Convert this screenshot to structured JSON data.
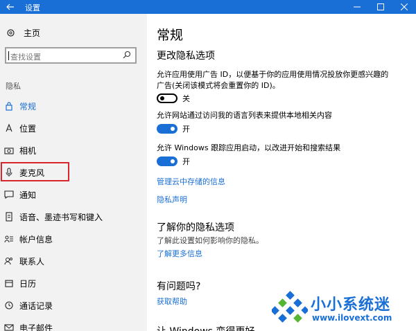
{
  "window": {
    "title": "设置",
    "back_icon": "back-arrow-icon",
    "controls": [
      "minimize-icon",
      "maximize-icon",
      "close-icon"
    ],
    "titlebar_color": "#1a6fd6"
  },
  "sidebar": {
    "home_label": "主页",
    "search_placeholder": "查找设置",
    "section_label": "隐私",
    "items": [
      {
        "label": "常规",
        "icon": "lock-icon",
        "active": true
      },
      {
        "label": "位置",
        "icon": "location-icon"
      },
      {
        "label": "相机",
        "icon": "camera-icon"
      },
      {
        "label": "麦克风",
        "icon": "microphone-icon",
        "highlighted": true
      },
      {
        "label": "通知",
        "icon": "notification-icon"
      },
      {
        "label": "语音、墨迹书写和键入",
        "icon": "speech-icon"
      },
      {
        "label": "帐户信息",
        "icon": "account-info-icon"
      },
      {
        "label": "联系人",
        "icon": "contacts-icon"
      },
      {
        "label": "日历",
        "icon": "calendar-icon"
      },
      {
        "label": "通话记录",
        "icon": "call-history-icon"
      },
      {
        "label": "电子邮件",
        "icon": "email-icon"
      }
    ]
  },
  "main": {
    "title": "常规",
    "section1_title": "更改隐私选项",
    "option1_text": "允许应用使用广告 ID，以便基于你的应用使用情况投放你更感兴趣的广告(关闭该模式将会重置你的 ID)。",
    "option1_state": "关",
    "option2_text": "允许网站通过访问我的语言列表来提供本地相关内容",
    "option2_state": "开",
    "option3_text": "允许 Windows 跟踪应用启动，以改进开始和搜索结果",
    "option3_state": "开",
    "link_cloud": "管理云中存储的信息",
    "link_privacy": "隐私声明",
    "section2_title": "了解你的隐私选项",
    "section2_desc": "了解此设置如何影响你的隐私。",
    "link_more": "了解更多信息",
    "section3_title": "有问题吗?",
    "link_help": "获取帮助",
    "section4_partial": "让 Windows 变得更好"
  },
  "watermark": {
    "title": "小小系统迷",
    "url": "www.ilovext.com"
  }
}
